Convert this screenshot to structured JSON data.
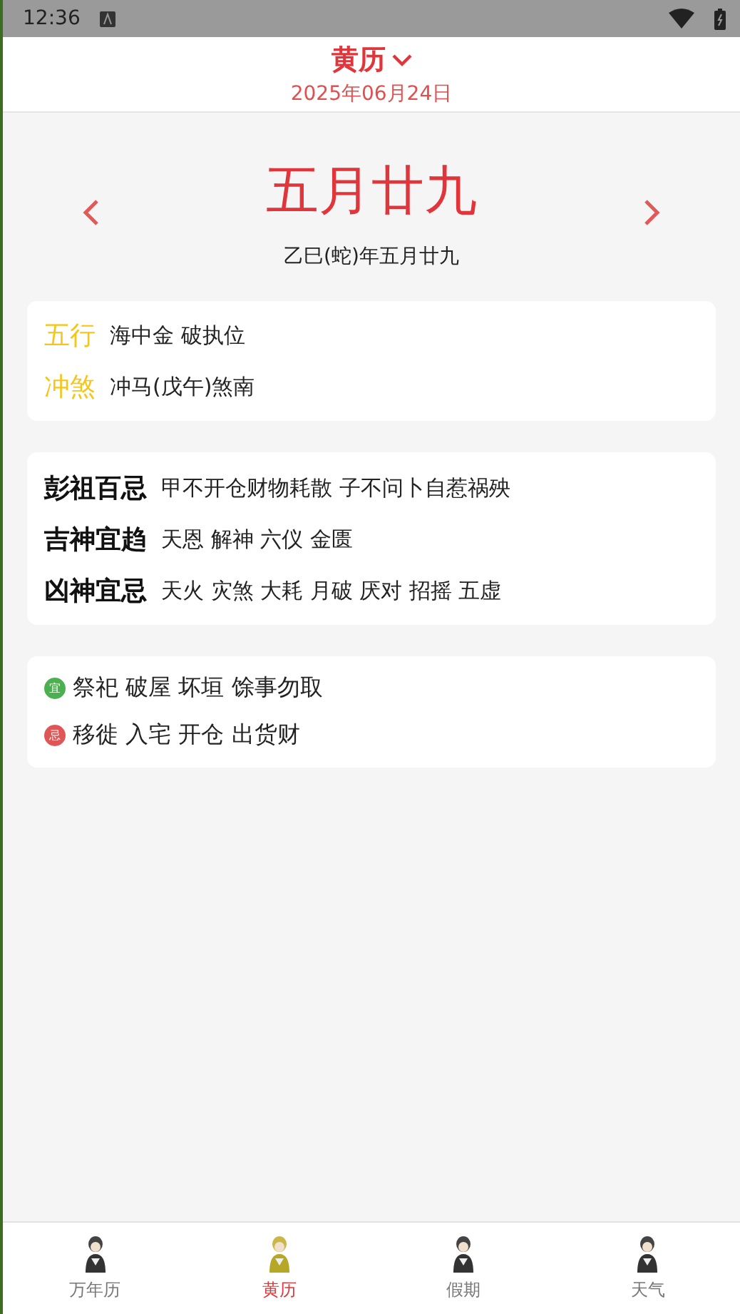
{
  "status_bar": {
    "time": "12:36"
  },
  "header": {
    "title": "黄历",
    "date": "2025年06月24日"
  },
  "lunar": {
    "day": "五月廿九",
    "full": "乙巳(蛇)年五月廿九"
  },
  "elements_card": [
    {
      "label": "五行",
      "value": "海中金 破执位"
    },
    {
      "label": "冲煞",
      "value": "冲马(戊午)煞南"
    }
  ],
  "gods_card": [
    {
      "label": "彭祖百忌",
      "value": "甲不开仓财物耗散 子不问卜自惹祸殃"
    },
    {
      "label": "吉神宜趋",
      "value": "天恩 解神 六仪 金匮"
    },
    {
      "label": "凶神宜忌",
      "value": "天火 灾煞 大耗 月破 厌对 招摇 五虚"
    }
  ],
  "advice_card": [
    {
      "badge": "宜",
      "color": "#4caf50",
      "value": "祭祀 破屋 坏垣 馀事勿取"
    },
    {
      "badge": "忌",
      "color": "#e05555",
      "value": "移徙 入宅 开仓 出货财"
    }
  ],
  "bottom_nav": [
    {
      "label": "万年历",
      "selected": false
    },
    {
      "label": "黄历",
      "selected": true
    },
    {
      "label": "假期",
      "selected": false
    },
    {
      "label": "天气",
      "selected": false
    }
  ]
}
